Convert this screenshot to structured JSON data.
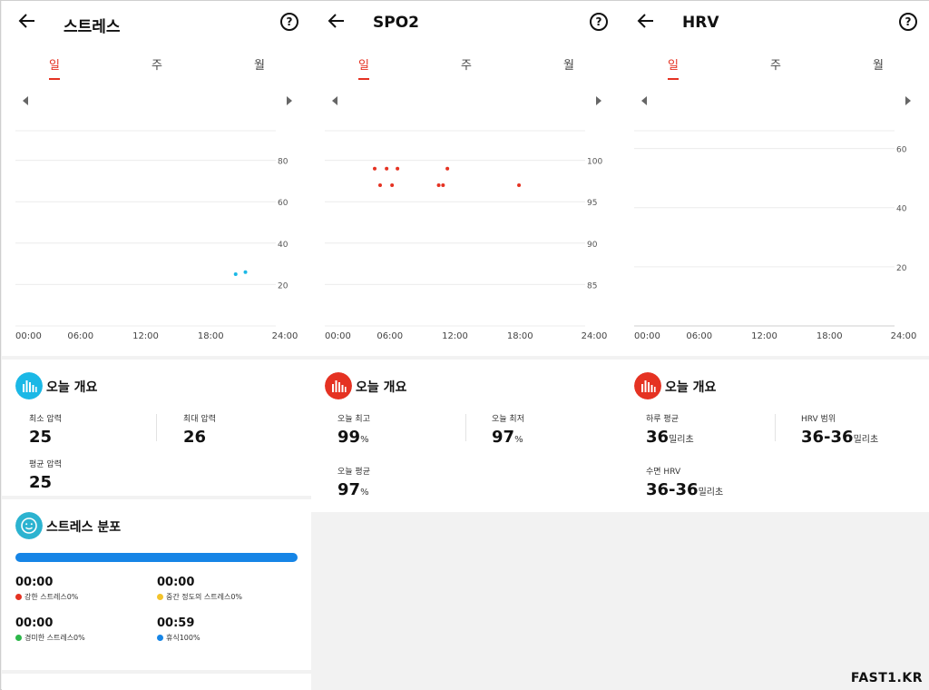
{
  "tabs": [
    "일",
    "주",
    "월"
  ],
  "colors": {
    "accent": "#e53222",
    "stress": "#1bb8e6",
    "spo2": "#e53222",
    "blue": "#1685e6"
  },
  "panels": [
    {
      "title": "스트레스",
      "overview_title": "오늘 개요",
      "chart": {
        "y_ticks": [
          "80",
          "60",
          "40",
          "20"
        ],
        "x_ticks": [
          "00:00",
          "06:00",
          "12:00",
          "18:00",
          "24:00"
        ]
      },
      "stats": [
        {
          "label": "최소 압력",
          "value": "25",
          "unit": ""
        },
        {
          "label": "최대 압력",
          "value": "26",
          "unit": ""
        },
        {
          "label": "평균 압력",
          "value": "25",
          "unit": ""
        }
      ],
      "distribution": {
        "title": "스트레스 분포",
        "items": [
          {
            "time": "00:00",
            "label": "강한 스트레스0%",
            "color": "#e53222"
          },
          {
            "time": "00:00",
            "label": "중간 정도의 스트레스0%",
            "color": "#f3c32b"
          },
          {
            "time": "00:00",
            "label": "경미한 스트레스0%",
            "color": "#2db74a"
          },
          {
            "time": "00:59",
            "label": "휴식100%",
            "color": "#1685e6"
          }
        ]
      }
    },
    {
      "title": "SPO2",
      "overview_title": "오늘 개요",
      "chart": {
        "y_ticks": [
          "100",
          "95",
          "90",
          "85"
        ],
        "x_ticks": [
          "00:00",
          "06:00",
          "12:00",
          "18:00",
          "24:00"
        ]
      },
      "stats": [
        {
          "label": "오늘 최고",
          "value": "99",
          "unit": "%"
        },
        {
          "label": "오늘 최저",
          "value": "97",
          "unit": "%"
        },
        {
          "label": "오늘 평균",
          "value": "97",
          "unit": "%"
        }
      ]
    },
    {
      "title": "HRV",
      "overview_title": "오늘 개요",
      "chart": {
        "y_ticks": [
          "60",
          "40",
          "20"
        ],
        "x_ticks": [
          "00:00",
          "06:00",
          "12:00",
          "18:00",
          "24:00"
        ]
      },
      "stats": [
        {
          "label": "하루 평균",
          "value": "36",
          "unit": "밀리초"
        },
        {
          "label": "HRV 범위",
          "value": "36-36",
          "unit": "밀리초"
        },
        {
          "label": "수면 HRV",
          "value": "36-36",
          "unit": "밀리초"
        }
      ]
    }
  ],
  "chart_data": [
    {
      "type": "scatter",
      "title": "스트레스",
      "xlabel": "",
      "ylabel": "",
      "xlim": [
        0,
        24
      ],
      "ylim": [
        0,
        100
      ],
      "points": [
        {
          "x": 20.3,
          "y": 25
        },
        {
          "x": 21.2,
          "y": 26
        }
      ]
    },
    {
      "type": "scatter",
      "title": "SPO2",
      "xlabel": "",
      "ylabel": "",
      "xlim": [
        0,
        24
      ],
      "ylim": [
        80,
        105
      ],
      "points": [
        {
          "x": 4.6,
          "y": 99
        },
        {
          "x": 5.1,
          "y": 97
        },
        {
          "x": 5.7,
          "y": 99
        },
        {
          "x": 6.2,
          "y": 97
        },
        {
          "x": 6.7,
          "y": 99
        },
        {
          "x": 10.5,
          "y": 97
        },
        {
          "x": 10.9,
          "y": 97
        },
        {
          "x": 11.3,
          "y": 99
        },
        {
          "x": 17.9,
          "y": 97
        }
      ]
    },
    {
      "type": "scatter",
      "title": "HRV",
      "xlabel": "",
      "ylabel": "",
      "xlim": [
        0,
        24
      ],
      "ylim": [
        0,
        70
      ],
      "points": []
    }
  ],
  "watermark": "FAST1.KR"
}
